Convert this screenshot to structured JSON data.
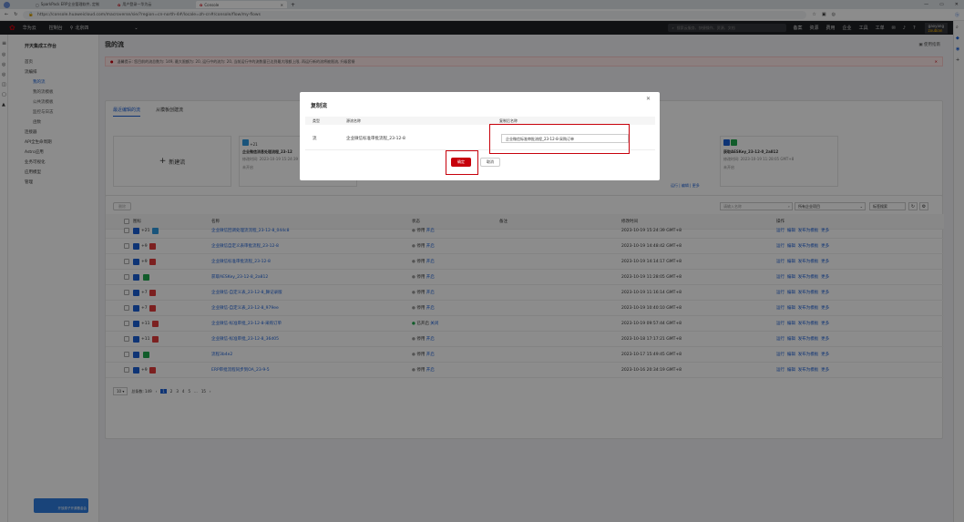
{
  "browser": {
    "tabs": [
      {
        "label": "SparkPack ERP企业管理软件, 定制"
      },
      {
        "label": "用户登录—华为云"
      },
      {
        "label": "Console"
      }
    ],
    "url": "https://console.huaweicloud.com/macroverse/sie/?region=cn-north-4#/locale=zh-cn#/console/flow/my-flows"
  },
  "topnav": {
    "brand": "华为云",
    "console": "控制台",
    "region": "北京四",
    "search_placeholder": "搜索云服务、快捷操作、资源、文档",
    "links": [
      "备案",
      "资源",
      "费用",
      "企业",
      "工具",
      "工单"
    ],
    "user": "gaoyang",
    "user_sub": "zoubian"
  },
  "sidebar": {
    "title": "开天集成工作台",
    "items": [
      {
        "label": "首页",
        "sub": false,
        "active": false
      },
      {
        "label": "流编排",
        "sub": false,
        "active": false
      },
      {
        "label": "我的流",
        "sub": true,
        "active": true
      },
      {
        "label": "我的流模板",
        "sub": true,
        "active": false
      },
      {
        "label": "公共流模板",
        "sub": true,
        "active": false
      },
      {
        "label": "监控与日志",
        "sub": true,
        "active": false
      },
      {
        "label": "函数",
        "sub": true,
        "active": false
      },
      {
        "label": "连接器",
        "sub": false,
        "active": false
      },
      {
        "label": "API全生命周期",
        "sub": false,
        "active": false
      },
      {
        "label": "Astro应用",
        "sub": false,
        "active": false
      },
      {
        "label": "业务可视化",
        "sub": false,
        "active": false
      },
      {
        "label": "应用模型",
        "sub": false,
        "active": false
      },
      {
        "label": "管理",
        "sub": false,
        "active": false
      }
    ],
    "banner": "开放原子开源基金会"
  },
  "main": {
    "title": "我的流",
    "help": "使用指南",
    "notice": "温馨提示: 您目前的流总数为: 149, 最大限额为: 20, 运行中的流为: 20, 当前运行中的流数量已达到最大限额上限, 再运行新的流将被限流, 升级套餐",
    "tab_recent": "最近编辑的流",
    "tab_template": "从模板创建流",
    "new_flow": "新建流",
    "recent_cards": [
      {
        "name": "企业微信消息处理流程_23-12",
        "time": "修改时间: 2023-10-19 15:24:39",
        "status": "未开启",
        "badge": "+21"
      },
      {
        "name": "获取AESKey_23-12-0_2a812",
        "time": "修改时间: 2023-10-19 11:28:05 GMT+8",
        "status": "未开启",
        "badge": ""
      }
    ],
    "card_actions": "运行 | 编辑 | 更多",
    "delete_btn": "删除",
    "filter_input_placeholder": "请输入名称",
    "filter_project": "所有企业项目",
    "filter_tag": "标签搜索",
    "table": {
      "headers": [
        "图标",
        "名称",
        "状态",
        "备注",
        "修改时间",
        "操作"
      ],
      "rows": [
        {
          "icon": "blue",
          "badge": "+21",
          "name": "企业微信回调处理流流程_23-12-8_044c8",
          "status": "停用",
          "toggle": "开启",
          "time": "2023-10-19 15:24:39 GMT+8"
        },
        {
          "icon": "red",
          "badge": "+9",
          "name": "企业微信自定义表审批流程_23-12-8",
          "status": "停用",
          "toggle": "开启",
          "time": "2023-10-19 14:48:42 GMT+8"
        },
        {
          "icon": "red",
          "badge": "+9",
          "name": "企业微信标准审批流程_23-12-8",
          "status": "停用",
          "toggle": "开启",
          "time": "2023-10-19 14:14:17 GMT+8"
        },
        {
          "icon": "green",
          "badge": "",
          "name": "获取AESKey_23-12-8_2a812",
          "status": "停用",
          "toggle": "开启",
          "time": "2023-10-19 11:28:05 GMT+8"
        },
        {
          "icon": "red",
          "badge": "+7",
          "name": "企业微信-自定义表_23-12-8_舞记录版",
          "status": "停用",
          "toggle": "开启",
          "time": "2023-10-19 11:16:14 GMT+8"
        },
        {
          "icon": "red",
          "badge": "+7",
          "name": "企业微信-自定义表_23-12-8_979ee",
          "status": "停用",
          "toggle": "开启",
          "time": "2023-10-19 10:40:10 GMT+8"
        },
        {
          "icon": "red",
          "badge": "+11",
          "name": "企业微信-标准审批_23-12-8-采购订单",
          "status": "已开启",
          "toggle": "关闭",
          "time": "2023-10-19 09:57:44 GMT+8"
        },
        {
          "icon": "red",
          "badge": "+11",
          "name": "企业微信-标准审批_23-12-8_36d05",
          "status": "停用",
          "toggle": "开启",
          "time": "2023-10-18 17:17:21 GMT+8"
        },
        {
          "icon": "green",
          "badge": "",
          "name": "流程3b4e2",
          "status": "停用",
          "toggle": "开启",
          "time": "2023-10-17 15:49:45 GMT+8"
        },
        {
          "icon": "red",
          "badge": "+9",
          "name": "ERP审批流程同步到OA_23-9-5",
          "status": "停用",
          "toggle": "开启",
          "time": "2023-10-16 20:34:19 GMT+8"
        }
      ],
      "row_actions": "运行  编辑  发布为模板  更多"
    },
    "pagination": {
      "page_size": "10",
      "total": "总条数: 149",
      "pages": [
        "1",
        "2",
        "3",
        "4",
        "5",
        "...",
        "15"
      ]
    }
  },
  "modal": {
    "title": "复制流",
    "col_type": "类型",
    "col_source": "源流名称",
    "col_target": "复制后名称",
    "type_value": "流",
    "source_value": "企业微信标准审批流程_23-12-8",
    "target_value": "企业微信标准审批流程_23-12-8-采购订单",
    "ok": "确定",
    "cancel": "取消"
  },
  "colors": {
    "primary": "#1a5fd6",
    "danger": "#c7000b",
    "topnav": "#1e1f24"
  }
}
